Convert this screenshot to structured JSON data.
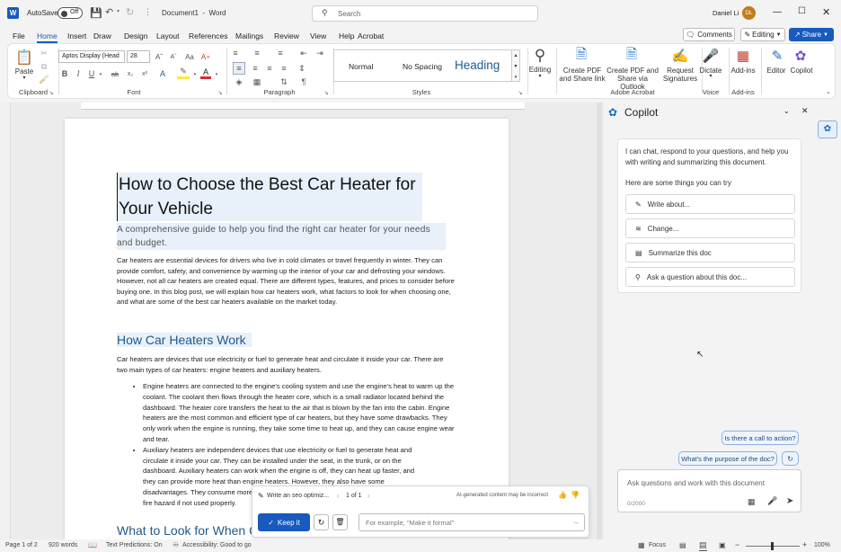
{
  "titlebar": {
    "autosave_label": "AutoSave",
    "autosave_state": "Off",
    "doc_name": "Document1",
    "app_name": "Word",
    "search_placeholder": "Search",
    "user_name": "Daniel Li",
    "user_initials": "DL"
  },
  "tabs": [
    "File",
    "Home",
    "Insert",
    "Draw",
    "Design",
    "Layout",
    "References",
    "Mailings",
    "Review",
    "View",
    "Help",
    "Acrobat"
  ],
  "active_tab": "Home",
  "top_right": {
    "comments": "Comments",
    "editing": "Editing",
    "share": "Share"
  },
  "ribbon": {
    "clipboard": {
      "paste": "Paste",
      "label": "Clipboard"
    },
    "font": {
      "name": "Aptos Display (Head",
      "size": "28",
      "label": "Font"
    },
    "paragraph": {
      "label": "Paragraph"
    },
    "styles": {
      "normal": "Normal",
      "no_spacing": "No Spacing",
      "heading": "Heading",
      "label": "Styles"
    },
    "editing": {
      "label": "Editing"
    },
    "acrobat": {
      "create_pdf_share": "Create PDF and Share link",
      "create_pdf_outlook": "Create PDF and Share via Outlook",
      "request_signatures": "Request Signatures",
      "label": "Adobe Acrobat"
    },
    "voice": {
      "dictate": "Dictate",
      "label": "Voice"
    },
    "addins": {
      "addins": "Add-ins",
      "label": "Add-ins"
    },
    "editor": "Editor",
    "copilot": "Copilot"
  },
  "document": {
    "title": "How to Choose the Best Car Heater for Your Vehicle",
    "subtitle": "A comprehensive guide to help you find the right car heater for your needs and budget.",
    "intro": "Car heaters are essential devices for drivers who live in cold climates or travel frequently in winter. They can provide comfort, safety, and convenience by warming up the interior of your car and defrosting your windows. However, not all car heaters are created equal. There are different types, features, and prices to consider before buying one. In this blog post, we will explain how car heaters work, what factors to look for when choosing one, and what are some of the best car heaters available on the market today.",
    "h2_1": "How Car Heaters Work",
    "p2": "Car heaters are devices that use electricity or fuel to generate heat and circulate it inside your car. There are two main types of car heaters: engine heaters and auxiliary heaters.",
    "bullet1": "Engine heaters are connected to the engine's cooling system and use the engine's heat to warm up the coolant. The coolant then flows through the heater core, which is a small radiator located behind the dashboard. The heater core transfers the heat to the air that is blown by the fan into the cabin. Engine heaters are the most common and efficient type of car heaters, but they have some drawbacks. They only work when the engine is running, they take some time to heat up, and they can cause engine wear and tear.",
    "bullet2_lines": [
      "Auxiliary heaters are independent devices that use electricity or fuel to generate heat and",
      "circulate it inside your car. They can be installed under the seat, in the trunk, or on the",
      "dashboard. Auxiliary heaters can work when the engine is off, they can heat up faster, and",
      "they can provide more heat than engine heaters. However, they also have some",
      "disadvantages. They consume more energy, they can drain the battery, and they can pose a",
      "fire hazard if not used properly."
    ],
    "h2_2": "What to Look for When Choosing a Car Heater"
  },
  "seo_bar": {
    "label": "Write an seo optimiz...",
    "pager": "1 of 1",
    "ai_note": "AI-generated content may be incorrect",
    "keep": "Keep it",
    "placeholder": "For example, \"Make it formal\""
  },
  "copilot": {
    "title": "Copilot",
    "intro": "I can chat, respond to your questions, and help you with writing and summarizing this document.",
    "things_label": "Here are some things you can try",
    "suggestions": [
      "Write about...",
      "Change...",
      "Summarize this doc",
      "Ask a question about this doc..."
    ],
    "chip1": "Is there a call to action?",
    "chip2": "What's the purpose of the doc?",
    "input_placeholder": "Ask questions and work with this document",
    "counter": "0/2000"
  },
  "status": {
    "page": "Page 1 of 2",
    "words": "920 words",
    "predictions": "Text Predictions: On",
    "accessibility": "Accessibility: Good to go",
    "focus": "Focus",
    "zoom": "100%"
  },
  "colors": {
    "accent": "#185abd",
    "heading": "#1f5a8a",
    "copilot_blue": "#0f6cbd"
  }
}
